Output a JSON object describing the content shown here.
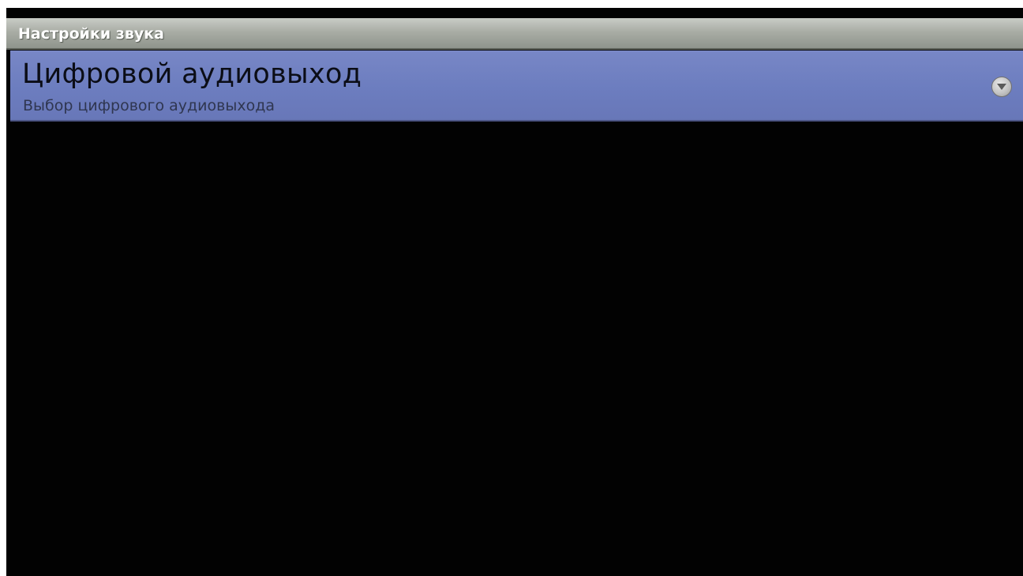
{
  "header": {
    "title": "Настройки звука"
  },
  "preferences": [
    {
      "title": "Цифровой аудиовыход",
      "summary": "Выбор цифрового аудиовыхода",
      "icon": "dropdown-arrow-icon"
    }
  ],
  "colors": {
    "background": "#020202",
    "title_bar": "#a9ada5",
    "selected_item": "#6c7dbf"
  }
}
